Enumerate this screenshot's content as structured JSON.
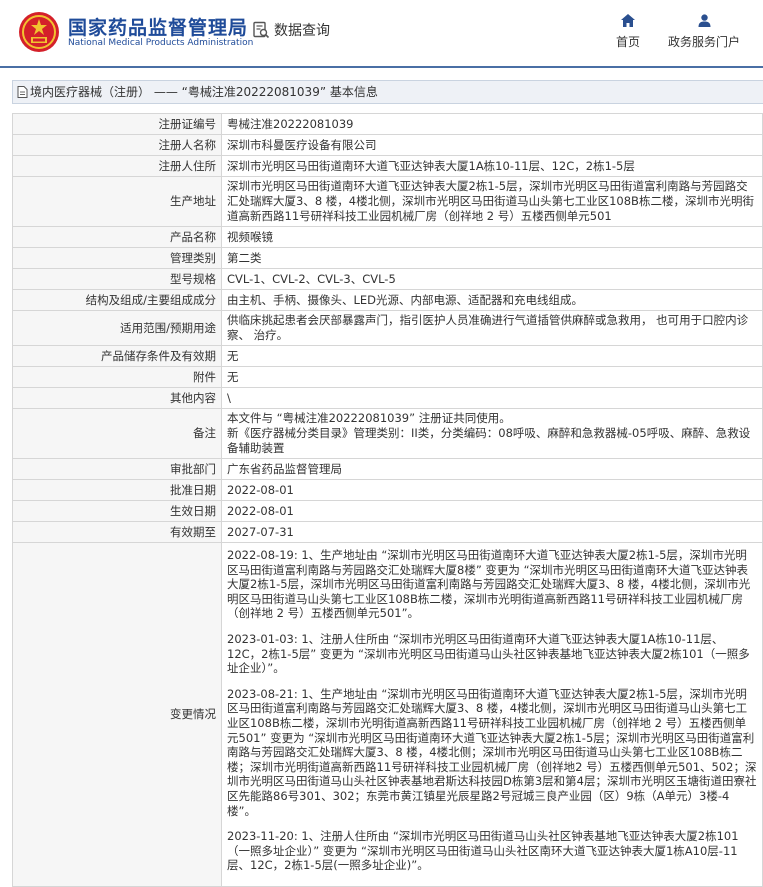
{
  "header": {
    "brand_cn": "国家药品监督管理局",
    "brand_en": "National Medical Products Administration",
    "data_query": "数据查询",
    "nav_home": "首页",
    "nav_user": "政务服务门户",
    "logo_icon": "national-emblem-icon",
    "brand_color": "#1f4b99"
  },
  "breadcrumb": "境内医疗器械（注册） —— “粤械注准20222081039” 基本信息",
  "fields": [
    {
      "label": "注册证编号",
      "value": "粤械注准20222081039"
    },
    {
      "label": "注册人名称",
      "value": "深圳市科曼医疗设备有限公司"
    },
    {
      "label": "注册人住所",
      "value": "深圳市光明区马田街道南环大道飞亚达钟表大厦1A栋10-11层、12C，2栋1-5层"
    },
    {
      "label": "生产地址",
      "value": "深圳市光明区马田街道南环大道飞亚达钟表大厦2栋1-5层，深圳市光明区马田街道富利南路与芳园路交汇处瑞辉大厦3、8 楼，4楼北侧，深圳市光明区马田街道马山头第七工业区108B栋二楼，深圳市光明街道高新西路11号研祥科技工业园机械厂房（创祥地 2 号）五楼西侧单元501"
    },
    {
      "label": "产品名称",
      "value": "视频喉镜"
    },
    {
      "label": "管理类别",
      "value": "第二类"
    },
    {
      "label": "型号规格",
      "value": "CVL-1、CVL-2、CVL-3、CVL-5"
    },
    {
      "label": "结构及组成/主要组成成分",
      "value": "由主机、手柄、摄像头、LED光源、内部电源、适配器和充电线组成。"
    },
    {
      "label": "适用范围/预期用途",
      "value": "供临床挑起患者会厌部暴露声门，指引医护人员准确进行气道插管供麻醉或急救用， 也可用于口腔内诊察、 治疗。"
    },
    {
      "label": "产品储存条件及有效期",
      "value": "无"
    },
    {
      "label": "附件",
      "value": "无"
    },
    {
      "label": "其他内容",
      "value": "\\"
    },
    {
      "label": "备注",
      "value": "本文件与 “粤械注准20222081039” 注册证共同使用。\n新《医疗器械分类目录》管理类别：II类，分类编码：08呼吸、麻醉和急救器械-05呼吸、麻醉、急救设备辅助装置"
    },
    {
      "label": "审批部门",
      "value": "广东省药品监督管理局"
    },
    {
      "label": "批准日期",
      "value": "2022-08-01"
    },
    {
      "label": "生效日期",
      "value": "2022-08-01"
    },
    {
      "label": "有效期至",
      "value": "2027-07-31"
    }
  ],
  "changes_label": "变更情况",
  "changes": [
    "2022-08-19: 1、生产地址由 “深圳市光明区马田街道南环大道飞亚达钟表大厦2栋1-5层，深圳市光明区马田街道富利南路与芳园路交汇处瑞辉大厦8楼” 变更为 “深圳市光明区马田街道南环大道飞亚达钟表大厦2栋1-5层，深圳市光明区马田街道富利南路与芳园路交汇处瑞辉大厦3、8 楼，4楼北侧，深圳市光明区马田街道马山头第七工业区108B栋二楼，深圳市光明街道高新西路11号研祥科技工业园机械厂房（创祥地 2 号）五楼西侧单元501”。",
    "2023-01-03: 1、注册人住所由 “深圳市光明区马田街道南环大道飞亚达钟表大厦1A栋10-11层、12C，2栋1-5层” 变更为 “深圳市光明区马田街道马山头社区钟表基地飞亚达钟表大厦2栋101（一照多址企业）”。",
    "2023-08-21: 1、生产地址由 “深圳市光明区马田街道南环大道飞亚达钟表大厦2栋1-5层，深圳市光明区马田街道富利南路与芳园路交汇处瑞辉大厦3、8 楼，4楼北侧，深圳市光明区马田街道马山头第七工业区108B栋二楼，深圳市光明街道高新西路11号研祥科技工业园机械厂房（创祥地 2 号）五楼西侧单元501” 变更为 “深圳市光明区马田街道南环大道飞亚达钟表大厦2栋1-5层；深圳市光明区马田街道富利南路与芳园路交汇处瑞辉大厦3、8 楼，4楼北侧；深圳市光明区马田街道马山头第七工业区108B栋二楼；深圳市光明街道高新西路11号研祥科技工业园机械厂房（创祥地2 号）五楼西侧单元501、502；深圳市光明区马田街道马山头社区钟表基地君斯达科技园D栋第3层和第4层；深圳市光明区玉塘街道田寮社区先能路86号301、302；东莞市黄江镇星光辰星路2号冠城三良产业园（区）9栋（A单元）3楼-4楼”。",
    "2023-11-20: 1、注册人住所由 “深圳市光明区马田街道马山头社区钟表基地飞亚达钟表大厦2栋101（一照多址企业）” 变更为 “深圳市光明区马田街道马山头社区南环大道飞亚达钟表大厦1栋A10层-11层、12C，2栋1-5层(一照多址企业)”。"
  ]
}
